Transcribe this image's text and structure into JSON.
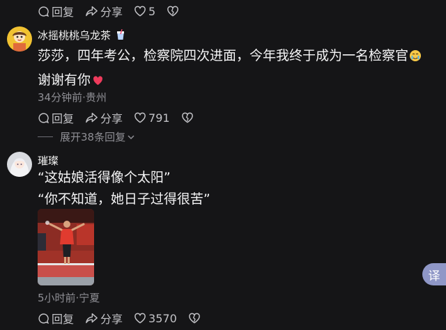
{
  "top_actions": {
    "reply": "回复",
    "share": "分享",
    "likes": "5"
  },
  "comment1": {
    "username": "冰摇桃桃乌龙茶",
    "line1": "莎莎，四年考公，检察院四次进面，今年我终于成为一名检察官",
    "line2": "谢谢有你",
    "meta": "34分钟前·贵州",
    "reply": "回复",
    "share": "分享",
    "likes": "791",
    "expand": "展开38条回复"
  },
  "comment2": {
    "username": "璀璨",
    "line1": "“这姑娘活得像个太阳”",
    "line2": "“你不知道，她日子过得很苦”",
    "meta": "5小时前·宁夏",
    "reply": "回复",
    "share": "分享",
    "likes": "3570"
  },
  "translate_label": "译"
}
